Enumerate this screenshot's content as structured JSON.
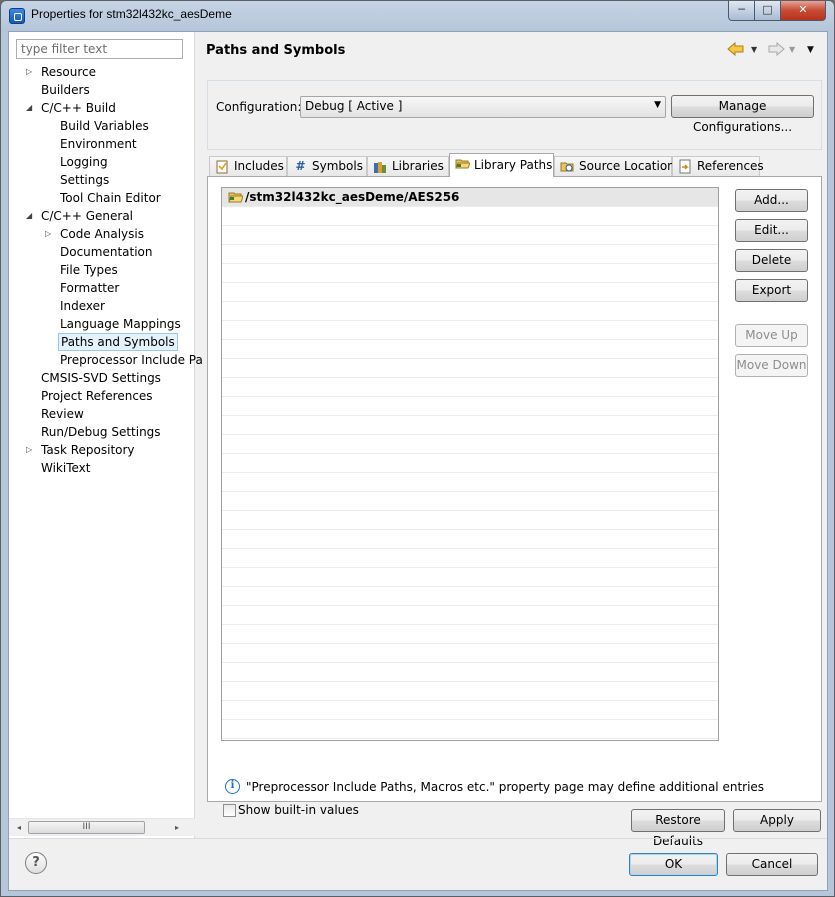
{
  "window": {
    "title": "Properties for stm32l432kc_aesDeme",
    "minimize_glyph": "─",
    "maximize_glyph": "□",
    "close_glyph": "✕"
  },
  "filter": {
    "placeholder": "type filter text"
  },
  "tree": [
    {
      "label": "Resource",
      "level": 0,
      "twisty": "collapsed",
      "icon": "chevron-right-icon"
    },
    {
      "label": "Builders",
      "level": 0,
      "twisty": "none"
    },
    {
      "label": "C/C++ Build",
      "level": 0,
      "twisty": "expanded",
      "icon": "chevron-down-icon"
    },
    {
      "label": "Build Variables",
      "level": 1,
      "twisty": "none"
    },
    {
      "label": "Environment",
      "level": 1,
      "twisty": "none"
    },
    {
      "label": "Logging",
      "level": 1,
      "twisty": "none"
    },
    {
      "label": "Settings",
      "level": 1,
      "twisty": "none"
    },
    {
      "label": "Tool Chain Editor",
      "level": 1,
      "twisty": "none"
    },
    {
      "label": "C/C++ General",
      "level": 0,
      "twisty": "expanded",
      "icon": "chevron-down-icon"
    },
    {
      "label": "Code Analysis",
      "level": 1,
      "twisty": "collapsed",
      "icon": "chevron-right-icon"
    },
    {
      "label": "Documentation",
      "level": 1,
      "twisty": "none"
    },
    {
      "label": "File Types",
      "level": 1,
      "twisty": "none"
    },
    {
      "label": "Formatter",
      "level": 1,
      "twisty": "none"
    },
    {
      "label": "Indexer",
      "level": 1,
      "twisty": "none"
    },
    {
      "label": "Language Mappings",
      "level": 1,
      "twisty": "none"
    },
    {
      "label": "Paths and Symbols",
      "level": 1,
      "twisty": "none",
      "selected": true
    },
    {
      "label": "Preprocessor Include Pa",
      "level": 1,
      "twisty": "none"
    },
    {
      "label": "CMSIS-SVD Settings",
      "level": 0,
      "twisty": "none"
    },
    {
      "label": "Project References",
      "level": 0,
      "twisty": "none"
    },
    {
      "label": "Review",
      "level": 0,
      "twisty": "none"
    },
    {
      "label": "Run/Debug Settings",
      "level": 0,
      "twisty": "none"
    },
    {
      "label": "Task Repository",
      "level": 0,
      "twisty": "collapsed",
      "icon": "chevron-right-icon"
    },
    {
      "label": "WikiText",
      "level": 0,
      "twisty": "none"
    }
  ],
  "left_scroll": {
    "thumb_glyph": "III",
    "left_glyph": "◂",
    "right_glyph": "▸"
  },
  "page": {
    "title": "Paths and Symbols",
    "nav_icons": [
      "back-arrow-icon",
      "dropdown-icon",
      "forward-arrow-icon",
      "dropdown-icon",
      "view-menu-icon"
    ]
  },
  "configuration": {
    "label": "Configuration:",
    "value": "Debug  [ Active ]",
    "manage_label": "Manage Configurations..."
  },
  "tabs": [
    {
      "label": "Includes",
      "icon": "includes-icon",
      "active": false
    },
    {
      "label": "Symbols",
      "icon": "hash-icon",
      "active": false
    },
    {
      "label": "Libraries",
      "icon": "libraries-icon",
      "active": false
    },
    {
      "label": "Library Paths",
      "icon": "folder-icon",
      "active": true
    },
    {
      "label": "Source Location",
      "icon": "source-folder-icon",
      "active": false
    },
    {
      "label": "References",
      "icon": "references-icon",
      "active": false
    }
  ],
  "library_paths": [
    "/stm32l432kc_aesDeme/AES256"
  ],
  "side_buttons": {
    "add": "Add...",
    "edit": "Edit...",
    "delete": "Delete",
    "export": "Export",
    "move_up": "Move Up",
    "move_down": "Move Down"
  },
  "info_text": "\"Preprocessor Include Paths, Macros etc.\" property page may define additional entries",
  "show_builtin": {
    "label": "Show built-in values",
    "checked": false
  },
  "restore_defaults": "Restore Defaults",
  "apply": "Apply",
  "ok": "OK",
  "cancel": "Cancel",
  "colors": {
    "selection_bg": "#e5f1fb",
    "selection_border": "#99c9ef",
    "row_selected": "#e6e6e6",
    "info_blue": "#1e6fc9",
    "back_arrow": "#e7a81c"
  }
}
